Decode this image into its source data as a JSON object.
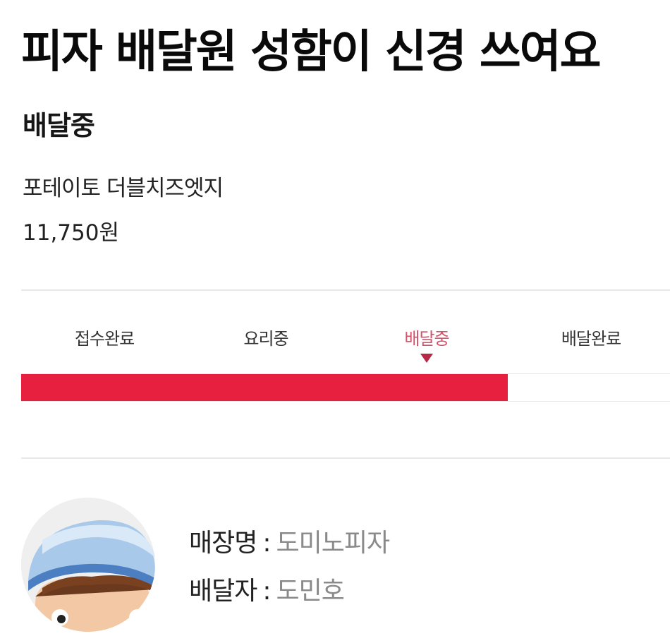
{
  "headline": "피자 배달원 성함이 신경 쓰여요",
  "order": {
    "status": "배달중",
    "item": "포테이토 더블치즈엣지",
    "price": "11,750원"
  },
  "progress": {
    "steps": [
      {
        "label": "접수완료",
        "active": false
      },
      {
        "label": "요리중",
        "active": false
      },
      {
        "label": "배달중",
        "active": true
      },
      {
        "label": "배달완료",
        "active": false
      }
    ],
    "fill_fraction": 0.75,
    "accent_color": "#e8203f",
    "active_label_color": "#d4516a"
  },
  "delivery_info": {
    "store_label": "매장명",
    "store_value": "도미노피자",
    "driver_label": "배달자",
    "driver_value": "도민호",
    "separator": ":"
  },
  "avatar": {
    "icon": "delivery-rider-helmet-avatar"
  }
}
